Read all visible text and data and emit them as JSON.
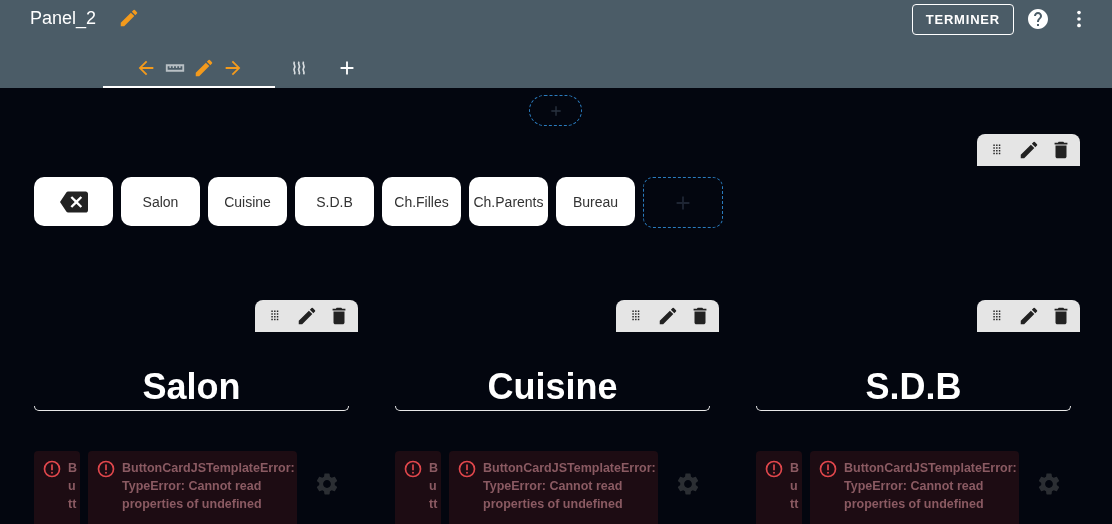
{
  "header": {
    "title": "Panel_2",
    "done_button": "TERMINER"
  },
  "tabs": [
    {
      "kind": "edit-view",
      "selected": true
    },
    {
      "kind": "heat-view",
      "selected": false
    },
    {
      "kind": "add",
      "selected": false
    }
  ],
  "room_buttons": [
    {
      "kind": "backspace"
    },
    {
      "kind": "label",
      "label": "Salon"
    },
    {
      "kind": "label",
      "label": "Cuisine"
    },
    {
      "kind": "label",
      "label": "S.D.B"
    },
    {
      "kind": "label",
      "label": "Ch.Filles"
    },
    {
      "kind": "label",
      "label": "Ch.Parents"
    },
    {
      "kind": "label",
      "label": "Bureau"
    },
    {
      "kind": "add"
    }
  ],
  "columns": [
    {
      "title": "Salon",
      "narrow_error_lines": [
        "B",
        "u",
        "tt"
      ],
      "error_message": "ButtonCardJSTemplateError: TypeError: Cannot read properties of undefined"
    },
    {
      "title": "Cuisine",
      "narrow_error_lines": [
        "B",
        "u",
        "tt"
      ],
      "error_message": "ButtonCardJSTemplateError: TypeError: Cannot read properties of undefined"
    },
    {
      "title": "S.D.B",
      "narrow_error_lines": [
        "B",
        "u",
        "tt"
      ],
      "error_message": "ButtonCardJSTemplateError: TypeError: Cannot read properties of undefined"
    }
  ]
}
